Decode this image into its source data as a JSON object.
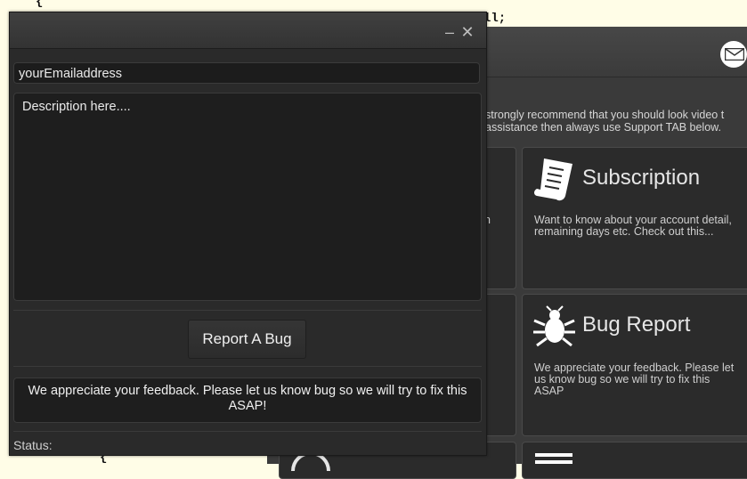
{
  "background_code": {
    "line1": "{",
    "line2": "ll;",
    "line3": "{"
  },
  "background_app": {
    "intro_text_1": "strongly recommend that you should look video t",
    "intro_text_2": "assistance then always use Support TAB below.",
    "left_fragment": "n",
    "tiles": [
      {
        "title": "Subscription",
        "desc": "Want to know about your account detail, remaining days etc. Check out this..."
      },
      {
        "title": "Bug Report",
        "desc": "We appreciate your feedback. Please let us know bug so we will try to fix this ASAP"
      }
    ]
  },
  "dialog": {
    "email_value": "yourEmailaddress",
    "description_value": "Description here....",
    "report_button": "Report A Bug",
    "feedback_message": "We appreciate your feedback. Please let us know bug so we will try to fix this ASAP!",
    "status_label": "Status:",
    "minimize_glyph": "–",
    "close_glyph": "✕"
  },
  "colors": {
    "code_background": "#fffde7",
    "dialog_bg": "#2a2a2a",
    "panel_bg": "#1e1e1e",
    "text": "#f0f0f0"
  },
  "icons": {
    "mail": "envelope-icon",
    "subscription": "receipt-icon",
    "bug": "bug-icon"
  }
}
